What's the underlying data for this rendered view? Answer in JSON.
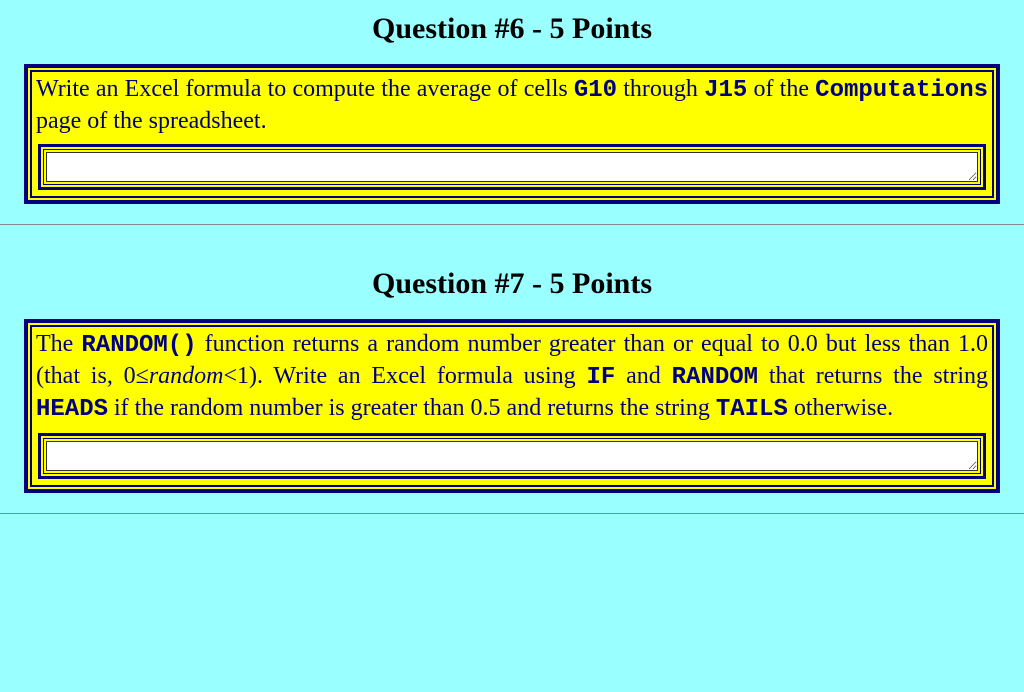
{
  "q6": {
    "title": "Question #6 - 5 Points",
    "prompt_a": "Write an Excel formula to compute the average of cells ",
    "cell1": "G10",
    "prompt_b": " through ",
    "cell2": "J15",
    "prompt_c": " of the ",
    "sheet": "Computations",
    "prompt_d": " page of the spreadsheet.",
    "answer": ""
  },
  "q7": {
    "title": "Question #7 - 5 Points",
    "p1": "The ",
    "fn_random": "RANDOM()",
    "p2": " function returns a random number greater than or equal to 0.0 but less than 1.0 (that is, 0≤",
    "varname": "random",
    "p3": "<1). Write an Excel formula using ",
    "fn_if": "IF",
    "p4": " and ",
    "fn_random2": "RANDOM",
    "p5": " that returns the string ",
    "heads": "HEADS",
    "p6": " if the random number is greater than 0.5 and returns the string ",
    "tails": "TAILS",
    "p7": " otherwise.",
    "answer": ""
  }
}
